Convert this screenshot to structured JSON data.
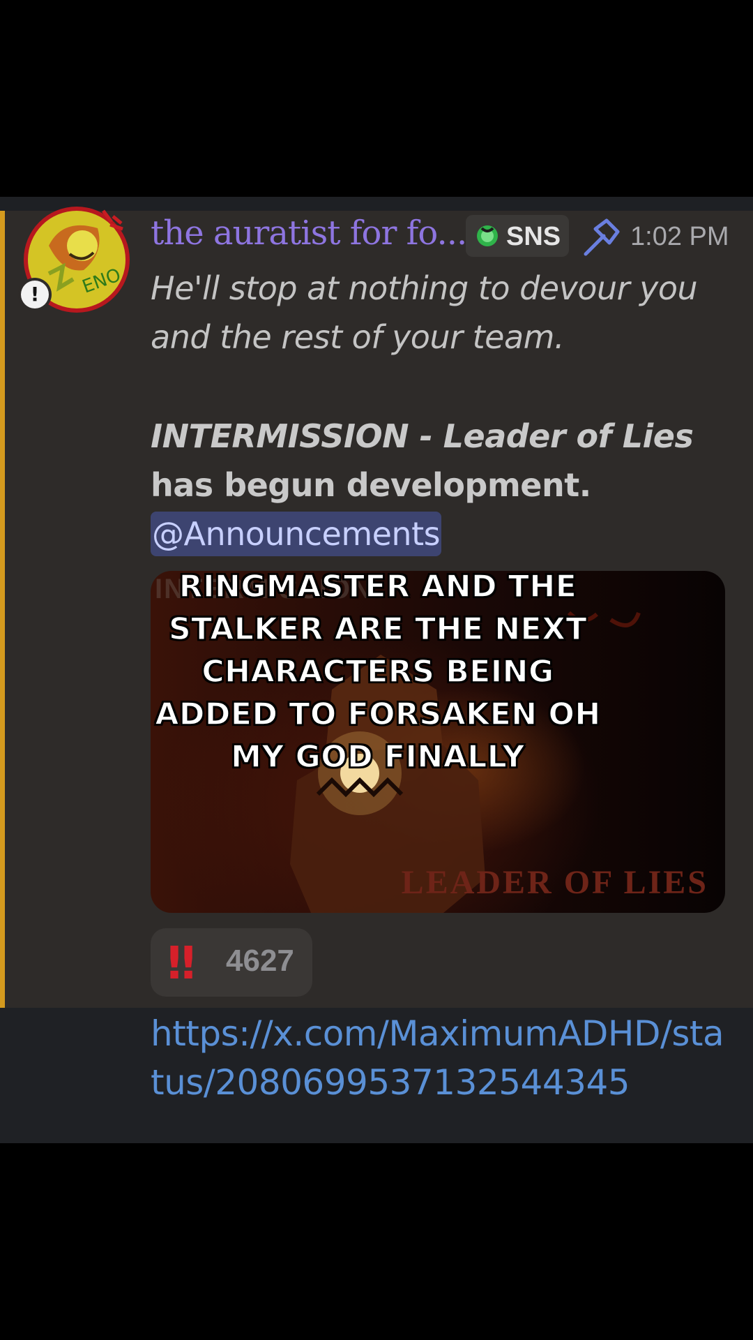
{
  "message": {
    "username": "the auratist for fo...",
    "tag": {
      "text": "SNS",
      "icon": "green-orb-icon"
    },
    "role_icon": "hammer-icon",
    "timestamp": "1:02 PM",
    "line1": "He'll stop at nothing to devour you and the rest of your team.",
    "line2": "INTERMISSION - Leader of Lies",
    "line3": "has begun development.",
    "mention": "@Announcements",
    "embed": {
      "ghost_text": "INTERMISSION",
      "caption": "LEADER OF LIES"
    },
    "reaction": {
      "emoji": "‼",
      "count": "4627"
    }
  },
  "overlay_caption": "RINGMASTER AND THE STALKER ARE THE NEXT CHARACTERS BEING ADDED TO FORSAKEN OH MY GOD FINALLY",
  "link": "https://x.com/MaximumADHD/status/2080699537132544345",
  "avatar": {
    "badge_text": "ENO",
    "warning": "!"
  },
  "colors": {
    "accent_bar": "#d49a1e",
    "username": "#8e75e0",
    "mention_bg": "#3d4470",
    "link": "#5a90d6",
    "reaction_emoji": "#d6202a"
  }
}
